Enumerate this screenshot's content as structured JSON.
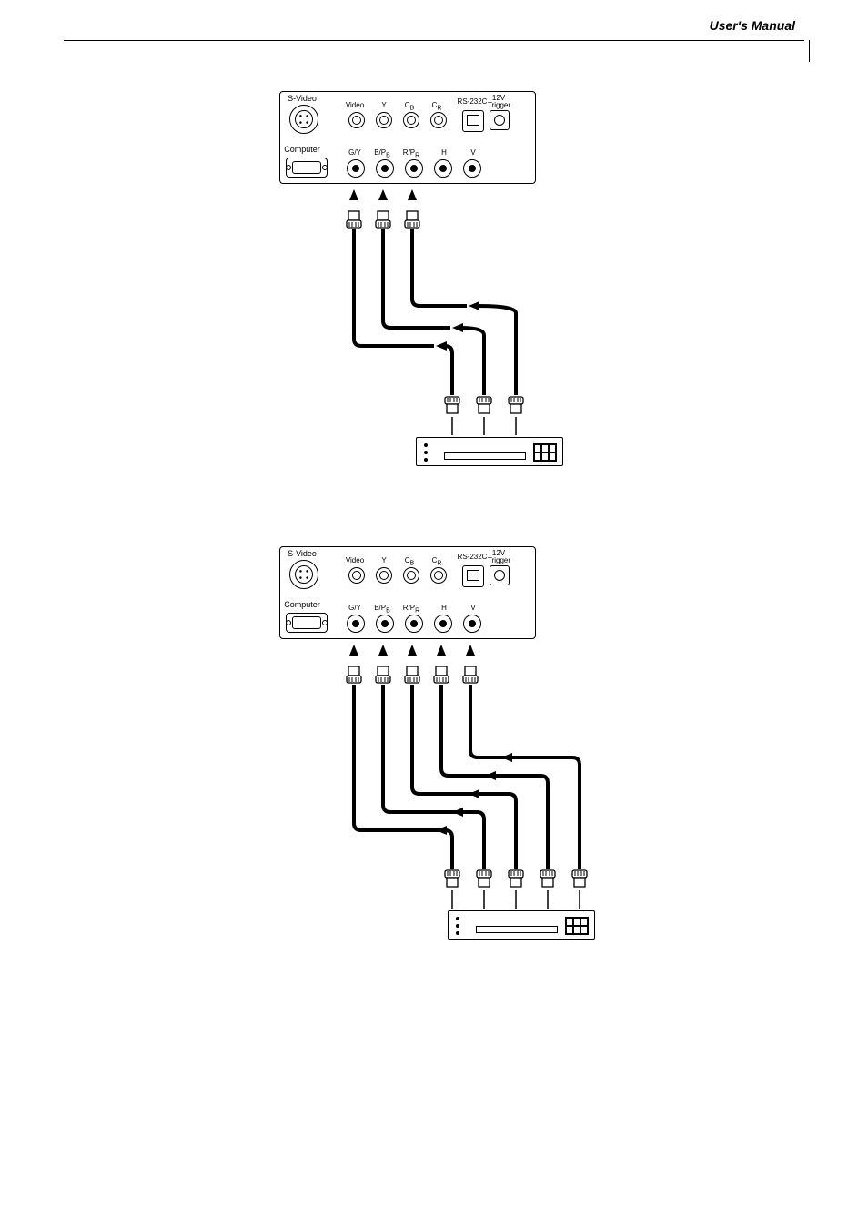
{
  "header": {
    "title": "User's Manual"
  },
  "panel": {
    "svideo": "S-Video",
    "computer": "Computer",
    "row1": {
      "video": "Video",
      "y": "Y",
      "cb": "C",
      "cb_sub": "B",
      "cr": "C",
      "cr_sub": "R",
      "rs232": "RS-232C",
      "v12": "12V",
      "trigger": "Trigger"
    },
    "row2": {
      "gy": "G/Y",
      "bpb": "B/P",
      "bpb_sub": "B",
      "rpr": "R/P",
      "rpr_sub": "R",
      "h": "H",
      "v": "V"
    }
  }
}
